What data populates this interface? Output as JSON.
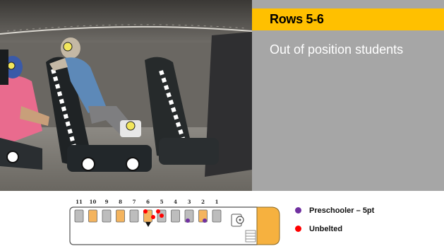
{
  "panel": {
    "title": "Rows 5-6",
    "subtitle": "Out of position students"
  },
  "diagram": {
    "row_numbers": [
      "11",
      "10",
      "9",
      "8",
      "7",
      "6",
      "5",
      "4",
      "3",
      "2",
      "1"
    ],
    "seat_fill_orange": "#f4b45e",
    "seat_fill_gray": "#bdbdbd",
    "bus_body_color": "#f6b13f"
  },
  "legend": {
    "items": [
      {
        "label": "Preschooler – 5pt",
        "color": "#7030a0"
      },
      {
        "label": "Unbelted",
        "color": "#ff0000"
      }
    ]
  },
  "colors": {
    "accent": "#ffc000",
    "panel_bg": "#a6a6a6",
    "preschooler": "#7030a0",
    "unbelted": "#ff0000"
  }
}
